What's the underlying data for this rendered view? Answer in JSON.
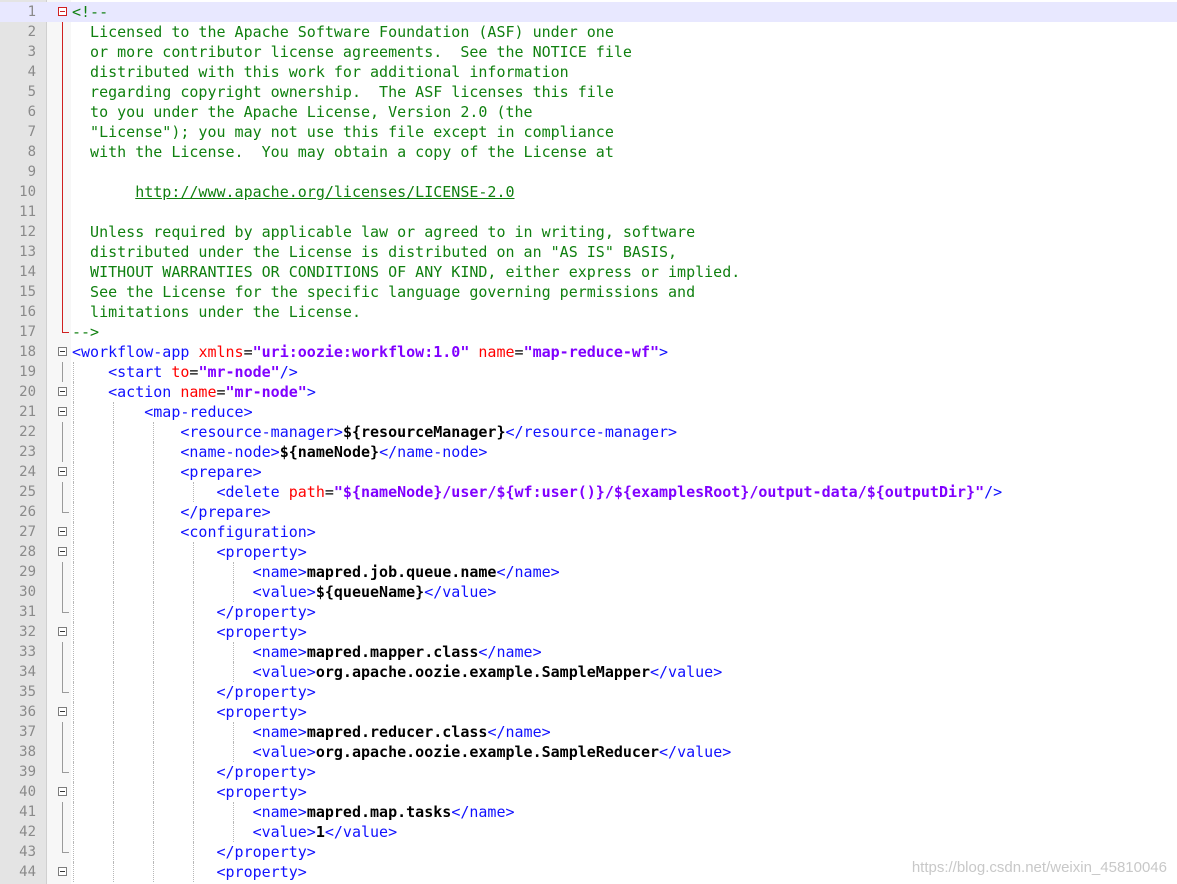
{
  "editor": {
    "lines": [
      {
        "n": "1",
        "fold": "open-red",
        "current": true,
        "guides": 0,
        "tokens": [
          [
            "cmt",
            "<!--"
          ]
        ]
      },
      {
        "n": "2",
        "fold": "bar-red",
        "guides": 0,
        "tokens": [
          [
            "cmt",
            "  Licensed to the Apache Software Foundation (ASF) under one"
          ]
        ]
      },
      {
        "n": "3",
        "fold": "bar-red",
        "guides": 0,
        "tokens": [
          [
            "cmt",
            "  or more contributor license agreements.  See the NOTICE file"
          ]
        ]
      },
      {
        "n": "4",
        "fold": "bar-red",
        "guides": 0,
        "tokens": [
          [
            "cmt",
            "  distributed with this work for additional information"
          ]
        ]
      },
      {
        "n": "5",
        "fold": "bar-red",
        "guides": 0,
        "tokens": [
          [
            "cmt",
            "  regarding copyright ownership.  The ASF licenses this file"
          ]
        ]
      },
      {
        "n": "6",
        "fold": "bar-red",
        "guides": 0,
        "tokens": [
          [
            "cmt",
            "  to you under the Apache License, Version 2.0 (the"
          ]
        ]
      },
      {
        "n": "7",
        "fold": "bar-red",
        "guides": 0,
        "tokens": [
          [
            "cmt",
            "  \"License\"); you may not use this file except in compliance"
          ]
        ]
      },
      {
        "n": "8",
        "fold": "bar-red",
        "guides": 0,
        "tokens": [
          [
            "cmt",
            "  with the License.  You may obtain a copy of the License at"
          ]
        ]
      },
      {
        "n": "9",
        "fold": "bar-red",
        "guides": 0,
        "tokens": []
      },
      {
        "n": "10",
        "fold": "bar-red",
        "guides": 0,
        "tokens": [
          [
            "cmt",
            "       "
          ],
          [
            "url",
            "http://www.apache.org/licenses/LICENSE-2.0"
          ]
        ]
      },
      {
        "n": "11",
        "fold": "bar-red",
        "guides": 0,
        "tokens": []
      },
      {
        "n": "12",
        "fold": "bar-red",
        "guides": 0,
        "tokens": [
          [
            "cmt",
            "  Unless required by applicable law or agreed to in writing, software"
          ]
        ]
      },
      {
        "n": "13",
        "fold": "bar-red",
        "guides": 0,
        "tokens": [
          [
            "cmt",
            "  distributed under the License is distributed on an \"AS IS\" BASIS,"
          ]
        ]
      },
      {
        "n": "14",
        "fold": "bar-red",
        "guides": 0,
        "tokens": [
          [
            "cmt",
            "  WITHOUT WARRANTIES OR CONDITIONS OF ANY KIND, either express or implied."
          ]
        ]
      },
      {
        "n": "15",
        "fold": "bar-red",
        "guides": 0,
        "tokens": [
          [
            "cmt",
            "  See the License for the specific language governing permissions and"
          ]
        ]
      },
      {
        "n": "16",
        "fold": "bar-red",
        "guides": 0,
        "tokens": [
          [
            "cmt",
            "  limitations under the License."
          ]
        ]
      },
      {
        "n": "17",
        "fold": "end-red",
        "guides": 0,
        "tokens": [
          [
            "cmt",
            "-->"
          ]
        ]
      },
      {
        "n": "18",
        "fold": "open",
        "guides": 0,
        "tokens": [
          [
            "tag",
            "<workflow-app "
          ],
          [
            "attr",
            "xmlns"
          ],
          [
            "pl",
            "="
          ],
          [
            "val",
            "\"uri:oozie:workflow:1.0\""
          ],
          [
            "pl",
            " "
          ],
          [
            "attr",
            "name"
          ],
          [
            "pl",
            "="
          ],
          [
            "val",
            "\"map-reduce-wf\""
          ],
          [
            "tag",
            ">"
          ]
        ]
      },
      {
        "n": "19",
        "fold": "bar",
        "guides": 1,
        "tokens": [
          [
            "pl",
            "    "
          ],
          [
            "tag",
            "<start "
          ],
          [
            "attr",
            "to"
          ],
          [
            "pl",
            "="
          ],
          [
            "val",
            "\"mr-node\""
          ],
          [
            "tag",
            "/>"
          ]
        ]
      },
      {
        "n": "20",
        "fold": "open",
        "guides": 1,
        "tokens": [
          [
            "pl",
            "    "
          ],
          [
            "tag",
            "<action "
          ],
          [
            "attr",
            "name"
          ],
          [
            "pl",
            "="
          ],
          [
            "val",
            "\"mr-node\""
          ],
          [
            "tag",
            ">"
          ]
        ]
      },
      {
        "n": "21",
        "fold": "open",
        "guides": 2,
        "tokens": [
          [
            "pl",
            "        "
          ],
          [
            "tag",
            "<map-reduce>"
          ]
        ]
      },
      {
        "n": "22",
        "fold": "bar",
        "guides": 3,
        "tokens": [
          [
            "pl",
            "            "
          ],
          [
            "tag",
            "<resource-manager>"
          ],
          [
            "txt",
            "${resourceManager}"
          ],
          [
            "tag",
            "</resource-manager>"
          ]
        ]
      },
      {
        "n": "23",
        "fold": "bar",
        "guides": 3,
        "tokens": [
          [
            "pl",
            "            "
          ],
          [
            "tag",
            "<name-node>"
          ],
          [
            "txt",
            "${nameNode}"
          ],
          [
            "tag",
            "</name-node>"
          ]
        ]
      },
      {
        "n": "24",
        "fold": "open",
        "guides": 3,
        "tokens": [
          [
            "pl",
            "            "
          ],
          [
            "tag",
            "<prepare>"
          ]
        ]
      },
      {
        "n": "25",
        "fold": "bar",
        "guides": 4,
        "tokens": [
          [
            "pl",
            "                "
          ],
          [
            "tag",
            "<delete "
          ],
          [
            "attr",
            "path"
          ],
          [
            "pl",
            "="
          ],
          [
            "val",
            "\"${nameNode}/user/${wf:user()}/${examplesRoot}/output-data/${outputDir}\""
          ],
          [
            "tag",
            "/>"
          ]
        ]
      },
      {
        "n": "26",
        "fold": "end",
        "guides": 3,
        "tokens": [
          [
            "pl",
            "            "
          ],
          [
            "tag",
            "</prepare>"
          ]
        ]
      },
      {
        "n": "27",
        "fold": "open",
        "guides": 3,
        "tokens": [
          [
            "pl",
            "            "
          ],
          [
            "tag",
            "<configuration>"
          ]
        ]
      },
      {
        "n": "28",
        "fold": "open",
        "guides": 4,
        "tokens": [
          [
            "pl",
            "                "
          ],
          [
            "tag",
            "<property>"
          ]
        ]
      },
      {
        "n": "29",
        "fold": "bar",
        "guides": 5,
        "tokens": [
          [
            "pl",
            "                    "
          ],
          [
            "tag",
            "<name>"
          ],
          [
            "txt",
            "mapred.job.queue.name"
          ],
          [
            "tag",
            "</name>"
          ]
        ]
      },
      {
        "n": "30",
        "fold": "bar",
        "guides": 5,
        "tokens": [
          [
            "pl",
            "                    "
          ],
          [
            "tag",
            "<value>"
          ],
          [
            "txt",
            "${queueName}"
          ],
          [
            "tag",
            "</value>"
          ]
        ]
      },
      {
        "n": "31",
        "fold": "end",
        "guides": 4,
        "tokens": [
          [
            "pl",
            "                "
          ],
          [
            "tag",
            "</property>"
          ]
        ]
      },
      {
        "n": "32",
        "fold": "open",
        "guides": 4,
        "tokens": [
          [
            "pl",
            "                "
          ],
          [
            "tag",
            "<property>"
          ]
        ]
      },
      {
        "n": "33",
        "fold": "bar",
        "guides": 5,
        "tokens": [
          [
            "pl",
            "                    "
          ],
          [
            "tag",
            "<name>"
          ],
          [
            "txt",
            "mapred.mapper.class"
          ],
          [
            "tag",
            "</name>"
          ]
        ]
      },
      {
        "n": "34",
        "fold": "bar",
        "guides": 5,
        "tokens": [
          [
            "pl",
            "                    "
          ],
          [
            "tag",
            "<value>"
          ],
          [
            "txt",
            "org.apache.oozie.example.SampleMapper"
          ],
          [
            "tag",
            "</value>"
          ]
        ]
      },
      {
        "n": "35",
        "fold": "end",
        "guides": 4,
        "tokens": [
          [
            "pl",
            "                "
          ],
          [
            "tag",
            "</property>"
          ]
        ]
      },
      {
        "n": "36",
        "fold": "open",
        "guides": 4,
        "tokens": [
          [
            "pl",
            "                "
          ],
          [
            "tag",
            "<property>"
          ]
        ]
      },
      {
        "n": "37",
        "fold": "bar",
        "guides": 5,
        "tokens": [
          [
            "pl",
            "                    "
          ],
          [
            "tag",
            "<name>"
          ],
          [
            "txt",
            "mapred.reducer.class"
          ],
          [
            "tag",
            "</name>"
          ]
        ]
      },
      {
        "n": "38",
        "fold": "bar",
        "guides": 5,
        "tokens": [
          [
            "pl",
            "                    "
          ],
          [
            "tag",
            "<value>"
          ],
          [
            "txt",
            "org.apache.oozie.example.SampleReducer"
          ],
          [
            "tag",
            "</value>"
          ]
        ]
      },
      {
        "n": "39",
        "fold": "end",
        "guides": 4,
        "tokens": [
          [
            "pl",
            "                "
          ],
          [
            "tag",
            "</property>"
          ]
        ]
      },
      {
        "n": "40",
        "fold": "open",
        "guides": 4,
        "tokens": [
          [
            "pl",
            "                "
          ],
          [
            "tag",
            "<property>"
          ]
        ]
      },
      {
        "n": "41",
        "fold": "bar",
        "guides": 5,
        "tokens": [
          [
            "pl",
            "                    "
          ],
          [
            "tag",
            "<name>"
          ],
          [
            "txt",
            "mapred.map.tasks"
          ],
          [
            "tag",
            "</name>"
          ]
        ]
      },
      {
        "n": "42",
        "fold": "bar",
        "guides": 5,
        "tokens": [
          [
            "pl",
            "                    "
          ],
          [
            "tag",
            "<value>"
          ],
          [
            "txt",
            "1"
          ],
          [
            "tag",
            "</value>"
          ]
        ]
      },
      {
        "n": "43",
        "fold": "end",
        "guides": 4,
        "tokens": [
          [
            "pl",
            "                "
          ],
          [
            "tag",
            "</property>"
          ]
        ]
      },
      {
        "n": "44",
        "fold": "open",
        "guides": 4,
        "tokens": [
          [
            "pl",
            "                "
          ],
          [
            "tag",
            "<property>"
          ]
        ]
      }
    ]
  },
  "watermark": "https://blog.csdn.net/weixin_45810046"
}
